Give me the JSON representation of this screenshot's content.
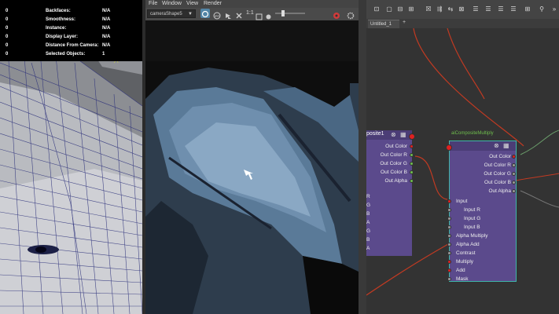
{
  "viewport": {
    "hud": [
      {
        "left": "0",
        "label": "Backfaces:",
        "value": "N/A"
      },
      {
        "left": "0",
        "label": "Smoothness:",
        "value": "N/A"
      },
      {
        "left": "0",
        "label": "Instance:",
        "value": "N/A"
      },
      {
        "left": "0",
        "label": "Display Layer:",
        "value": "N/A"
      },
      {
        "left": "0",
        "label": "Distance From Camera:",
        "value": "N/A"
      },
      {
        "left": "0",
        "label": "Selected Objects:",
        "value": "1"
      }
    ]
  },
  "render_view": {
    "menu": [
      "File",
      "Window",
      "View",
      "Render"
    ],
    "camera": "cameraShape5",
    "zoom_label": "1:1",
    "icons": [
      "render-region-icon",
      "snapshot-icon",
      "ipr-icon",
      "refresh-icon",
      "zoom-icon",
      "exposure-icon",
      "gamma-slider",
      "color-management-icon",
      "settings-icon"
    ]
  },
  "node_editor": {
    "tab_label": "Untitled_1",
    "add_tab": "+",
    "composite_node": {
      "title": "posite1",
      "outputs": [
        "Out Color",
        "Out Color R",
        "Out Color G",
        "Out Color B",
        "Out Alpha"
      ],
      "inputs": [
        "R",
        "G",
        "B",
        "A",
        "G",
        "B",
        "A"
      ]
    },
    "multiply_node": {
      "title": "aiCompositeMultiply",
      "outputs": [
        "Out Color",
        "Out Color R",
        "Out Color G",
        "Out Color B",
        "Out Alpha"
      ],
      "inputs": [
        "Input",
        "Input R",
        "Input G",
        "Input B",
        "Alpha Multiply",
        "Alpha Add",
        "Contrast",
        "Multiply",
        "Add",
        "Mask"
      ]
    }
  },
  "colors": {
    "node_body": "#5b4a8c",
    "node_header": "#4b3d76",
    "connection_red": "#c23a22",
    "selected_outline": "#3fb6a8"
  }
}
